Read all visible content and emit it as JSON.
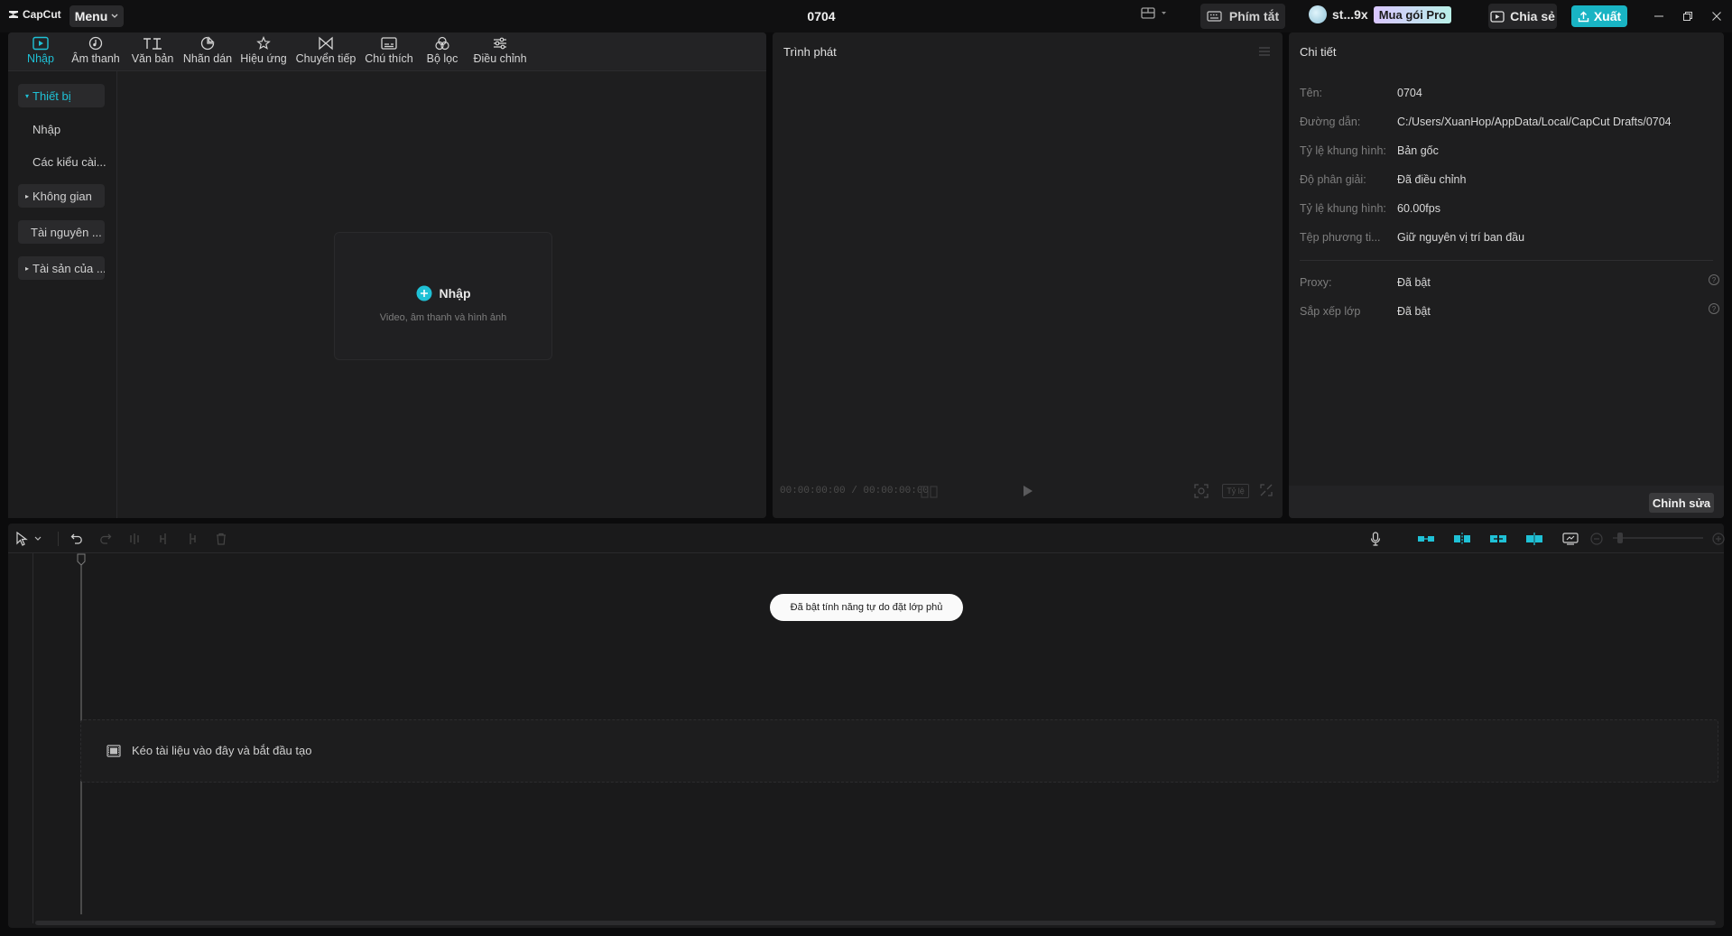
{
  "titlebar": {
    "logo": "CapCut",
    "menu_label": "Menu",
    "project_title": "0704",
    "shortcut_label": "Phím tắt",
    "user_name": "st...9x",
    "pro_label": "Mua gói Pro",
    "share_label": "Chia sẻ",
    "export_label": "Xuất"
  },
  "media": {
    "tabs": [
      {
        "label": "Nhập",
        "icon": "import-icon"
      },
      {
        "label": "Âm thanh",
        "icon": "audio-icon"
      },
      {
        "label": "Văn bản",
        "icon": "text-icon"
      },
      {
        "label": "Nhãn dán",
        "icon": "sticker-icon"
      },
      {
        "label": "Hiệu ứng",
        "icon": "effects-icon"
      },
      {
        "label": "Chuyển tiếp",
        "icon": "transition-icon"
      },
      {
        "label": "Chú thích",
        "icon": "caption-icon"
      },
      {
        "label": "Bộ lọc",
        "icon": "filter-icon"
      },
      {
        "label": "Điều chỉnh",
        "icon": "adjust-icon"
      }
    ],
    "sidebar": {
      "device": "Thiết bị",
      "import": "Nhập",
      "styles": "Các kiểu cài...",
      "space": "Không gian",
      "resources": "Tài nguyên ...",
      "assets": "Tài sản của ..."
    },
    "import_box": {
      "title": "Nhập",
      "subtitle": "Video, âm thanh và hình ảnh"
    }
  },
  "player": {
    "title": "Trình phát",
    "timecode": "00:00:00:00 / 00:00:00:00",
    "ratio_label": "Tỷ lệ"
  },
  "details": {
    "title": "Chi tiết",
    "rows": [
      {
        "label": "Tên:",
        "value": "0704"
      },
      {
        "label": "Đường dẫn:",
        "value": "C:/Users/XuanHop/AppData/Local/CapCut Drafts/0704"
      },
      {
        "label": "Tỷ lệ khung hình:",
        "value": "Bản gốc"
      },
      {
        "label": "Độ phân giải:",
        "value": "Đã điều chỉnh"
      },
      {
        "label": "Tỷ lệ khung hình:",
        "value": "60.00fps"
      },
      {
        "label": "Tệp phương ti...",
        "value": "Giữ nguyên vị trí ban đầu"
      }
    ],
    "extra_rows": [
      {
        "label": "Proxy:",
        "value": "Đã bật"
      },
      {
        "label": "Sắp xếp lớp",
        "value": "Đã bật"
      }
    ],
    "edit_label": "Chỉnh sửa"
  },
  "timeline": {
    "toast": "Đã bật tính năng tự do đặt lớp phủ",
    "drop_hint": "Kéo tài liệu vào đây và bắt đầu tạo"
  },
  "colors": {
    "accent": "#1fc1d6",
    "export": "#19b4c4",
    "panel": "#1e1e1f"
  }
}
